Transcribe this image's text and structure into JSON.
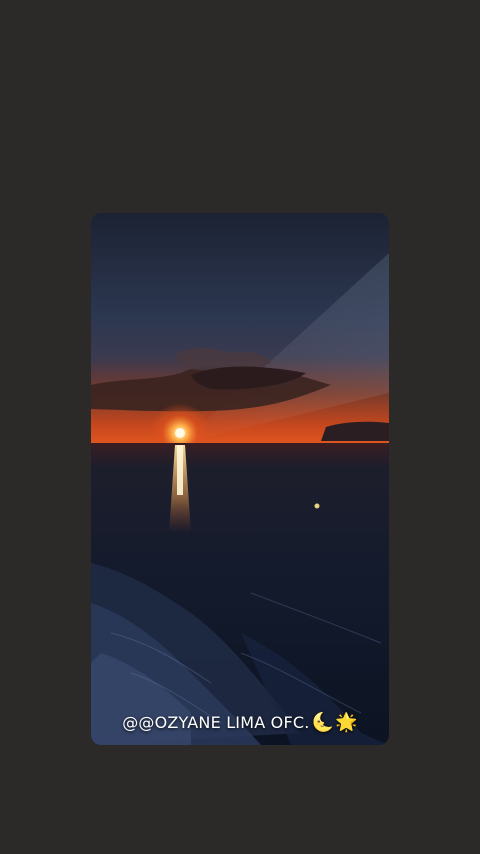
{
  "story": {
    "caption_text": "@@OZYANE LIMA OFC.",
    "caption_emoji_moon": "🌜",
    "caption_emoji_star": "🌟"
  },
  "colors": {
    "page_background": "#2b2a29",
    "sky_top": "#1d2436",
    "horizon": "#d9461e",
    "sea": "#111a2e"
  },
  "icons": [
    "moon-emoji-icon",
    "star-emoji-icon"
  ]
}
